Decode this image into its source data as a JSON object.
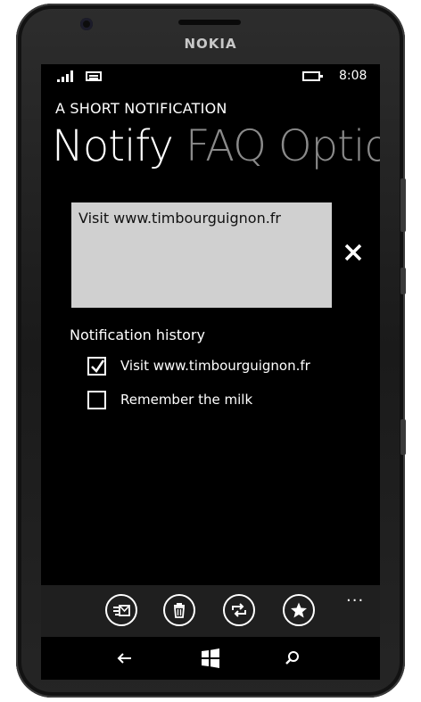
{
  "device": {
    "brand": "NOKIA"
  },
  "status_bar": {
    "time": "8:08"
  },
  "app": {
    "title": "A SHORT NOTIFICATION"
  },
  "pivot": {
    "items": [
      "Notify",
      "FAQ",
      "Options"
    ],
    "selected": 0
  },
  "notification": {
    "text": "Visit www.timbourguignon.fr"
  },
  "history": {
    "label": "Notification history",
    "items": [
      {
        "label": "Visit www.timbourguignon.fr",
        "checked": true
      },
      {
        "label": "Remember the milk",
        "checked": false
      }
    ]
  },
  "app_bar": {
    "buttons": [
      "send-notification-icon",
      "delete-icon",
      "sync-icon",
      "favorite-icon"
    ],
    "more": "..."
  },
  "nav_bar": {
    "buttons": [
      "back-icon",
      "windows-start-icon",
      "search-icon"
    ]
  }
}
